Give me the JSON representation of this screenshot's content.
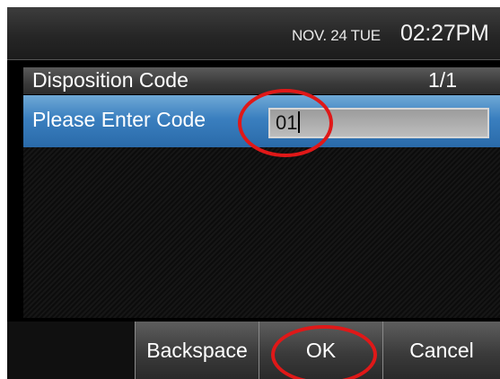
{
  "status_bar": {
    "date": "NOV. 24 TUE",
    "time": "02:27PM"
  },
  "title_bar": {
    "title": "Disposition Code",
    "page": "1/1"
  },
  "form": {
    "label": "Please Enter Code",
    "input_value": "01"
  },
  "softkeys": {
    "backspace": "Backspace",
    "ok": "OK",
    "cancel": "Cancel"
  },
  "annotation_color": "#e01818"
}
